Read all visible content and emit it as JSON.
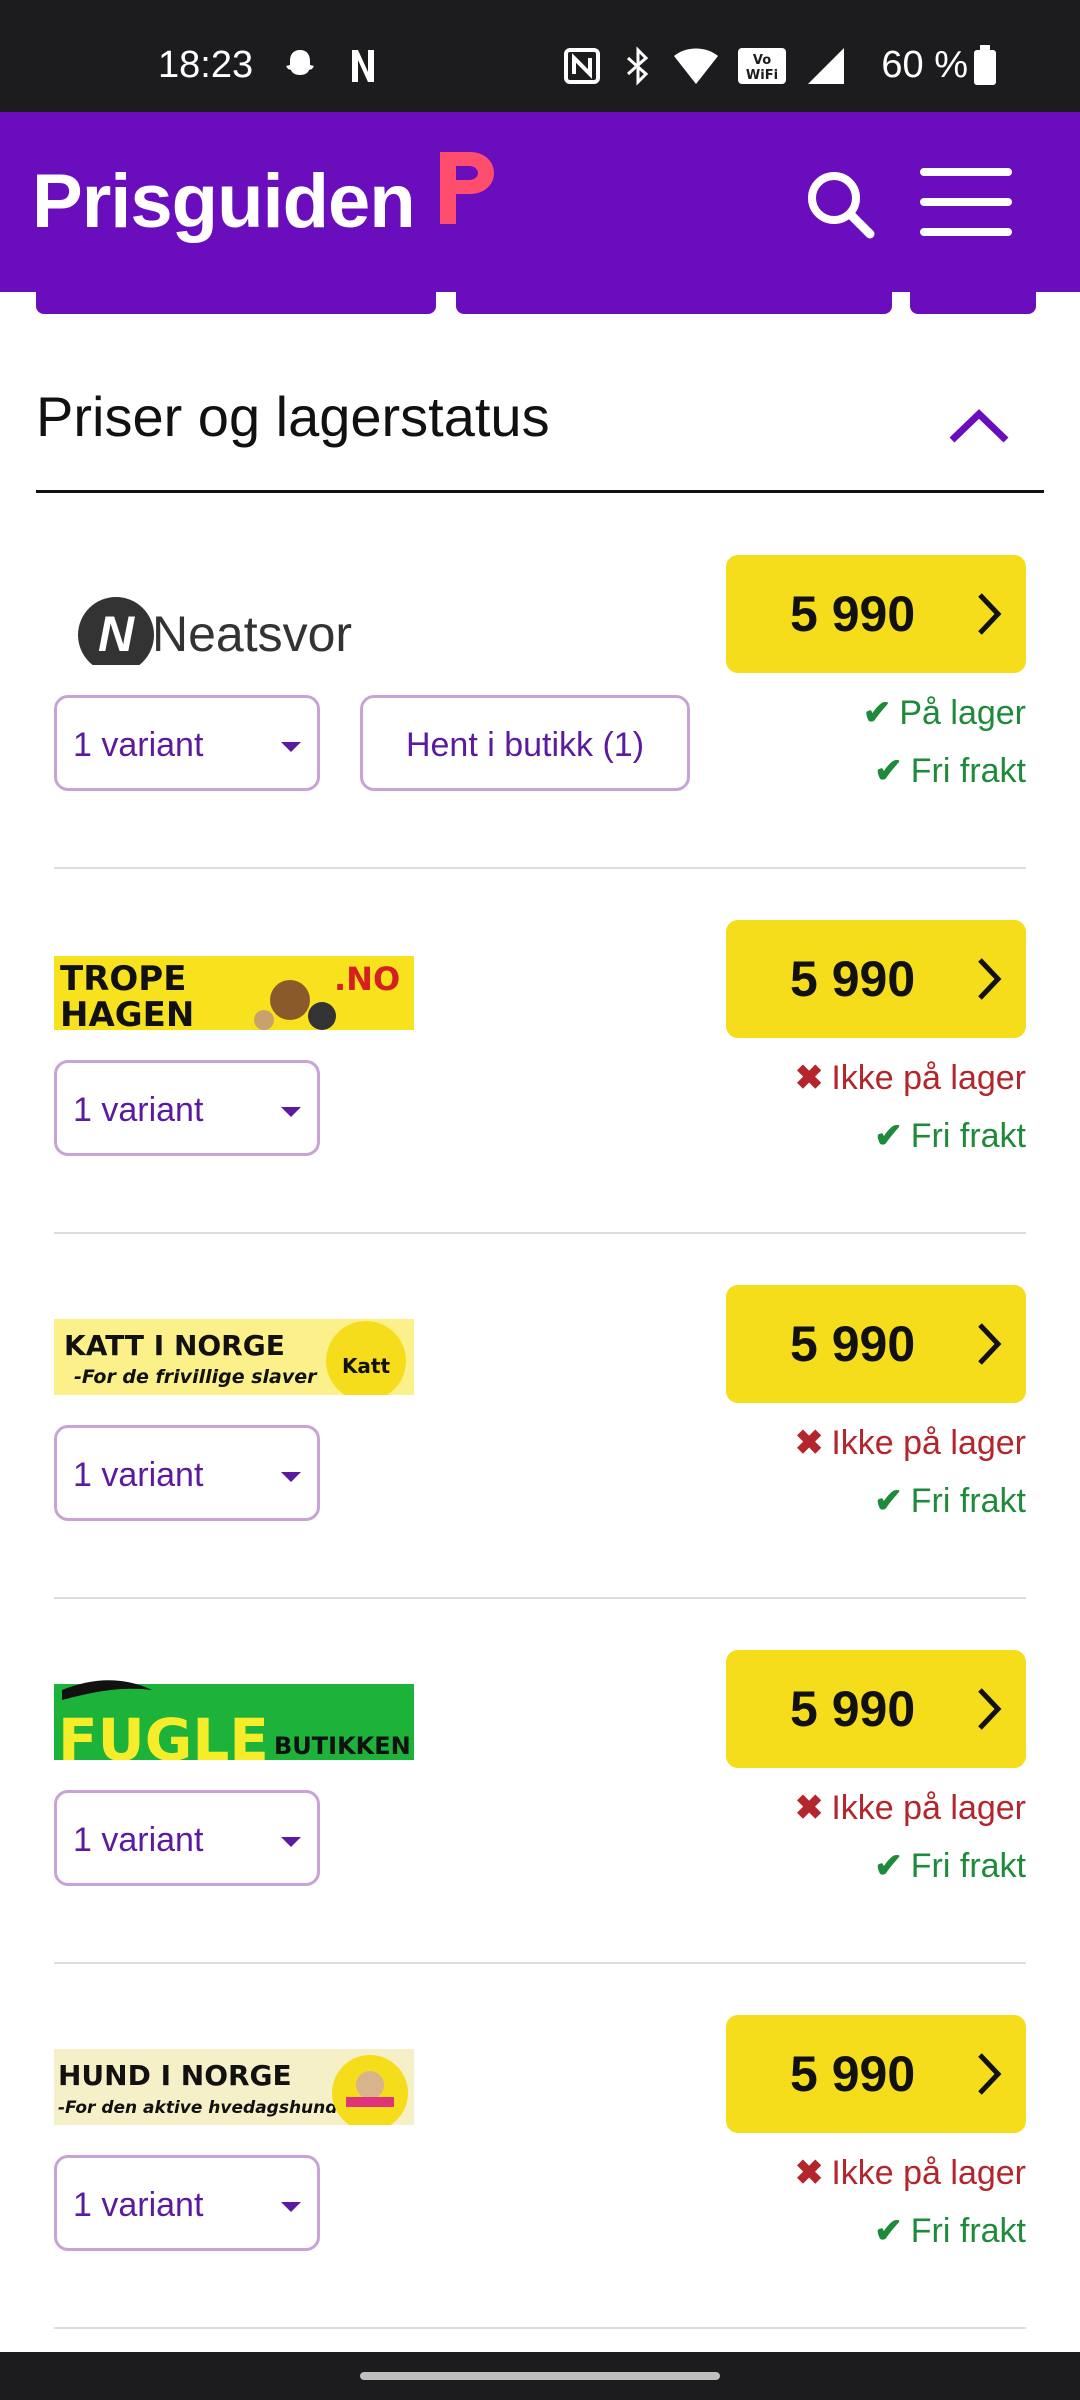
{
  "status_bar": {
    "time": "18:23",
    "battery": "60 %",
    "icons": [
      "snapchat-icon",
      "netflix-icon",
      "nfc-icon",
      "bluetooth-icon",
      "wifi-icon",
      "vowifi-icon",
      "signal-icon",
      "battery-icon"
    ]
  },
  "header": {
    "logo": "Prisguiden",
    "brand_color": "#6a0dbc",
    "accent_color": "#ff4d6d",
    "search_icon": "search-icon",
    "menu_icon": "hamburger-menu-icon"
  },
  "section": {
    "title": "Priser og lagerstatus",
    "toggle_icon": "chevron-up-icon"
  },
  "offers": [
    {
      "store": "Neatsvor",
      "price": "5 990",
      "variant": "1 variant",
      "pickup": "Hent i butikk (1)",
      "stock": "På lager",
      "in_stock": true,
      "shipping": "Fri frakt"
    },
    {
      "store": "TROPE HAGEN .NO",
      "logo_line1": "TROPE",
      "logo_line2": "HAGEN",
      "logo_suffix": ".NO",
      "price": "5 990",
      "variant": "1 variant",
      "stock": "Ikke på lager",
      "in_stock": false,
      "shipping": "Fri frakt"
    },
    {
      "store": "KATT I NORGE",
      "logo_line1": "KATT I NORGE",
      "logo_line2": "-For de frivillige slaver",
      "badge": "Katt i Norge",
      "price": "5 990",
      "variant": "1 variant",
      "stock": "Ikke på lager",
      "in_stock": false,
      "shipping": "Fri frakt"
    },
    {
      "store": "FUGLE BUTIKKEN",
      "logo_line1": "FUGLE",
      "logo_line2": "BUTIKKEN",
      "price": "5 990",
      "variant": "1 variant",
      "stock": "Ikke på lager",
      "in_stock": false,
      "shipping": "Fri frakt"
    },
    {
      "store": "HUND I NORGE",
      "logo_line1": "HUND I NORGE",
      "logo_line2": "-For den aktive hvedagshunden",
      "price": "5 990",
      "variant": "1 variant",
      "stock": "Ikke på lager",
      "in_stock": false,
      "shipping": "Fri frakt"
    }
  ],
  "colors": {
    "price_button": "#f5dd1b",
    "in_stock": "#1e8a3a",
    "out_of_stock": "#b3262c",
    "variant_text": "#5b1aa0"
  }
}
